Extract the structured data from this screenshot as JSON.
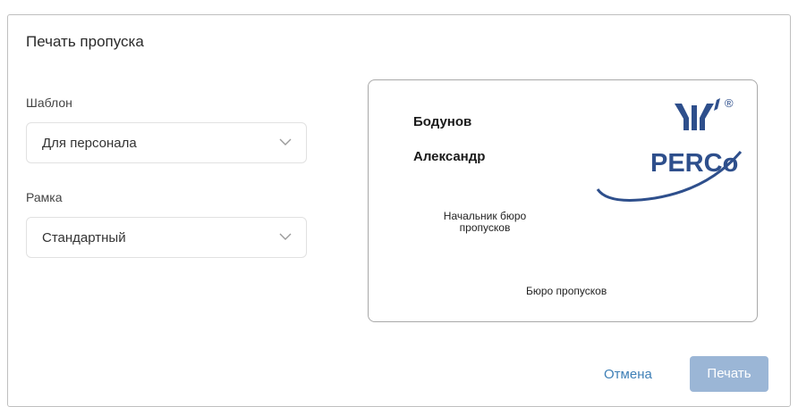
{
  "dialog": {
    "title": "Печать пропуска",
    "template_label": "Шаблон",
    "template_value": "Для персонала",
    "frame_label": "Рамка",
    "frame_value": "Стандартный"
  },
  "card": {
    "last_name": "Бодунов",
    "first_name": "Александр",
    "position": "Начальник бюро пропусков",
    "department": "Бюро пропусков",
    "logo_text": "PERCo",
    "logo_mark": "®"
  },
  "footer": {
    "cancel_label": "Отмена",
    "print_label": "Печать"
  },
  "colors": {
    "logo_blue": "#2e4f8c",
    "link_blue": "#3e7fb6",
    "print_button": "#9bb6d6"
  }
}
